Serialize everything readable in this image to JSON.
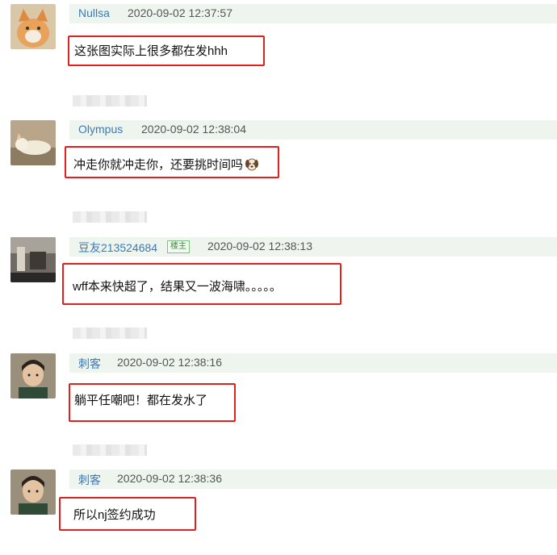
{
  "comments": [
    {
      "username": "Nullsa",
      "time": "2020-09-02 12:37:57",
      "text": "这张图实际上很多都在发hhh"
    },
    {
      "username": "Olympus",
      "time": "2020-09-02 12:38:04",
      "text": "冲走你就冲走你，还要挑时间吗",
      "emoji": "puppy-face-icon"
    },
    {
      "username": "豆友213524684",
      "badge": "楼主",
      "time": "2020-09-02 12:38:13",
      "text": "wff本来快超了，结果又一波海啸。。。。。"
    },
    {
      "username": "刺客",
      "time": "2020-09-02 12:38:16",
      "text": "躺平任嘲吧！都在发水了"
    },
    {
      "username": "刺客",
      "time": "2020-09-02 12:38:36",
      "text": "所以nj签约成功"
    }
  ],
  "colors": {
    "username": "#3a7ab8",
    "header_bg": "#eef5ee",
    "highlight_box": "#e0201c"
  }
}
